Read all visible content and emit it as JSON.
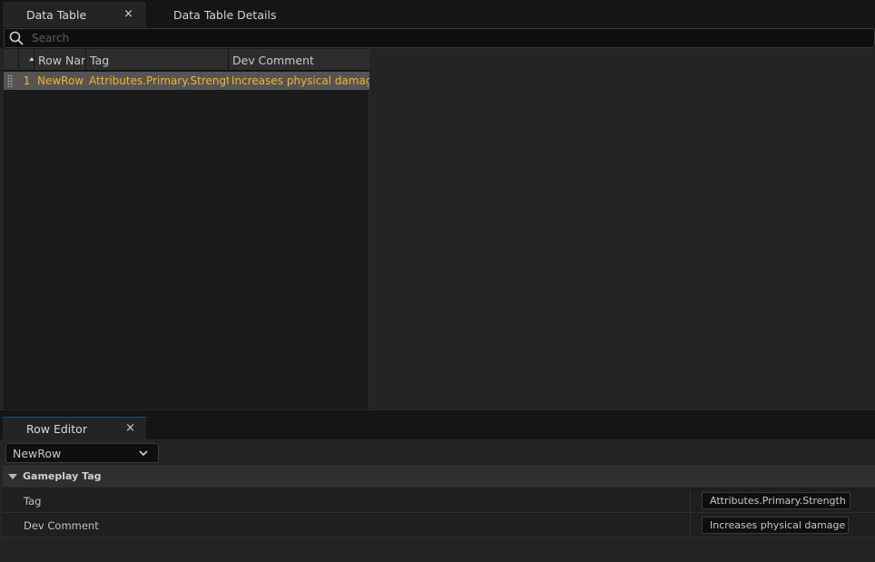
{
  "tabs": {
    "data_table": {
      "label": "Data Table",
      "close": "×"
    },
    "details": {
      "label": "Data Table Details"
    }
  },
  "search": {
    "placeholder": "Search",
    "value": ""
  },
  "table": {
    "columns": [
      "Row Name",
      "Tag",
      "Dev Comment"
    ],
    "rows": [
      {
        "index": "1",
        "row_name": "NewRow",
        "tag": "Attributes.Primary.Strength",
        "dev_comment": "Increases physical damage"
      }
    ]
  },
  "row_editor": {
    "tab_label": "Row Editor",
    "close": "×",
    "selected_row": "NewRow",
    "category": "Gameplay Tag",
    "properties": [
      {
        "name": "Tag",
        "value": "Attributes.Primary.Strength"
      },
      {
        "name": "Dev Comment",
        "value": "Increases physical damage"
      }
    ]
  },
  "colors": {
    "highlight_text": "#f7b228",
    "selected_row_bg": "#545454",
    "panel_bg": "#242424"
  },
  "icons": {
    "search": "search-icon",
    "close": "close-icon",
    "dropdown": "chevron-down-icon",
    "expand": "triangle-down-icon"
  }
}
